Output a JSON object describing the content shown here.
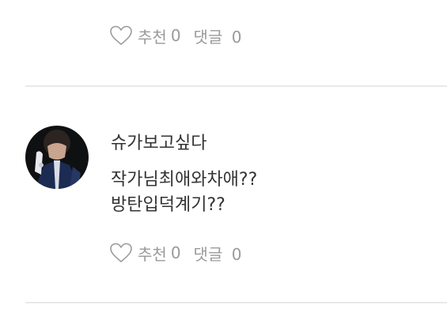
{
  "previous_comment": {
    "actions": {
      "like_label": "추천",
      "like_count": "0",
      "reply_label": "댓글",
      "reply_count": "0"
    }
  },
  "comment": {
    "author": "슈가보고싶다",
    "lines": [
      "작가님최애와차애??",
      "방탄입덕계기??"
    ],
    "actions": {
      "like_label": "추천",
      "like_count": "0",
      "reply_label": "댓글",
      "reply_count": "0"
    }
  },
  "colors": {
    "action_text": "#9a9a9a",
    "body_text": "#333333",
    "divider": "#e9e9e9"
  },
  "icons": {
    "like": "heart-outline-icon"
  }
}
